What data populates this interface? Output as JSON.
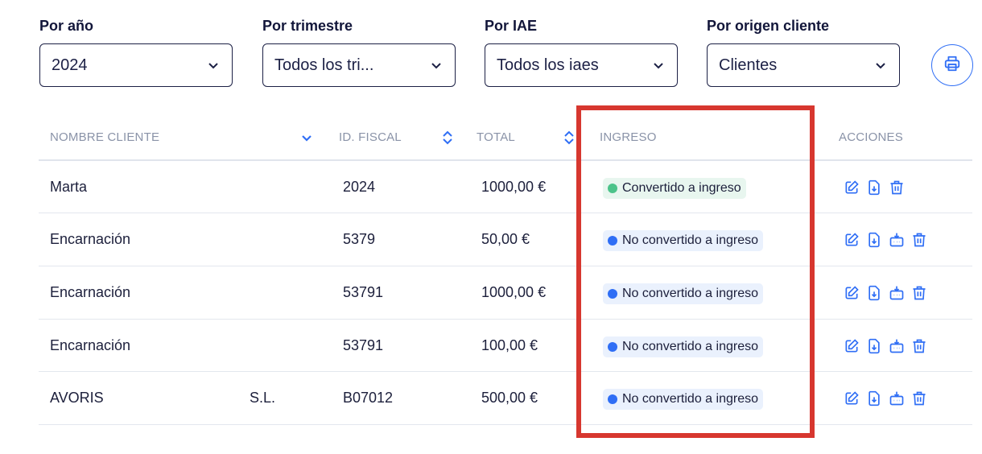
{
  "filters": [
    {
      "label": "Por año",
      "value": "2024"
    },
    {
      "label": "Por trimestre",
      "value": "Todos los tri..."
    },
    {
      "label": "Por IAE",
      "value": "Todos los iaes"
    },
    {
      "label": "Por origen cliente",
      "value": "Clientes"
    }
  ],
  "print_icon": "printer-icon",
  "table": {
    "columns": [
      "NOMBRE CLIENTE",
      "ID. FISCAL",
      "TOTAL",
      "INGRESO",
      "ACCIONES"
    ],
    "rows": [
      {
        "name": "Marta",
        "suffix": "",
        "fiscal_id": "2024",
        "total": "1000,00 €",
        "ingreso": "Convertido a ingreso",
        "status": "green",
        "actions": [
          "edit-icon",
          "download-icon",
          "delete-icon"
        ]
      },
      {
        "name": "Encarnación",
        "suffix": "",
        "fiscal_id": "5379",
        "total": "50,00 €",
        "ingreso": "No convertido a ingreso",
        "status": "blue",
        "actions": [
          "edit-icon",
          "download-icon",
          "convert-icon",
          "delete-icon"
        ]
      },
      {
        "name": "Encarnación",
        "suffix": "",
        "fiscal_id": "53791",
        "total": "1000,00 €",
        "ingreso": "No convertido a ingreso",
        "status": "blue",
        "actions": [
          "edit-icon",
          "download-icon",
          "convert-icon",
          "delete-icon"
        ]
      },
      {
        "name": "Encarnación",
        "suffix": "",
        "fiscal_id": "53791",
        "total": "100,00 €",
        "ingreso": "No convertido a ingreso",
        "status": "blue",
        "actions": [
          "edit-icon",
          "download-icon",
          "convert-icon",
          "delete-icon"
        ]
      },
      {
        "name": "AVORIS",
        "suffix": "S.L.",
        "fiscal_id": "B07012",
        "total": "500,00 €",
        "ingreso": "No convertido a ingreso",
        "status": "blue",
        "actions": [
          "edit-icon",
          "download-icon",
          "convert-icon",
          "delete-icon"
        ]
      }
    ]
  },
  "colors": {
    "accent": "#2f6ef5",
    "highlight": "#d7372f",
    "status_green": "#4cc38a",
    "status_blue": "#2f6ef5"
  }
}
